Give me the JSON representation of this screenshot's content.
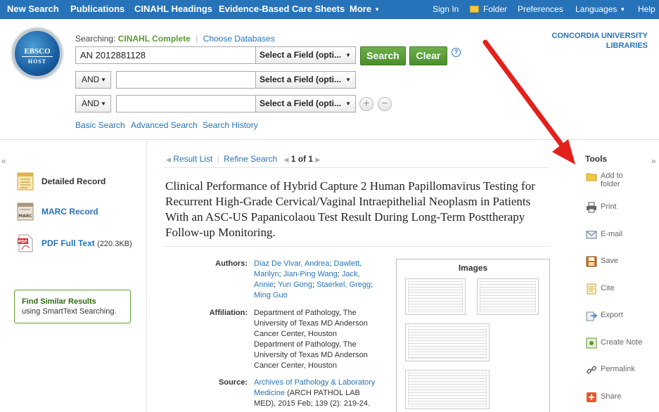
{
  "nav": {
    "items": [
      "New Search",
      "Publications",
      "CINAHL Headings",
      "Evidence-Based Care Sheets",
      "More"
    ],
    "right": [
      "Sign In",
      "Folder",
      "Preferences",
      "Languages",
      "Help"
    ]
  },
  "logo": {
    "line1": "EBSCO",
    "line2": "HOST"
  },
  "search": {
    "searching_label": "Searching:",
    "database": "CINAHL Complete",
    "choose_db": "Choose Databases",
    "row1_value": "AN 2012881128",
    "field_select": "Select a Field (opti...",
    "bool1": "AND",
    "bool2": "AND",
    "search_btn": "Search",
    "clear_btn": "Clear",
    "help": "?",
    "add_row": "+",
    "remove_row": "−",
    "links": [
      "Basic Search",
      "Advanced Search",
      "Search History"
    ]
  },
  "institution": {
    "line1": "CONCORDIA UNIVERSITY",
    "line2": "LIBRARIES"
  },
  "left": {
    "collapse": "«",
    "detailed": "Detailed Record",
    "marc": "MARC Record",
    "marc_icon_text": "MARC",
    "pdf": "PDF Full Text",
    "pdf_icon_text": "PDF",
    "pdf_size": "(220.3KB)",
    "similar_title": "Find Similar Results",
    "similar_sub": "using SmartText Searching."
  },
  "record": {
    "result_list": "Result List",
    "refine": "Refine Search",
    "page": "1 of 1",
    "title": "Clinical Performance of Hybrid Capture 2 Human Papillomavirus Testing for Recurrent High-Grade Cervical/Vaginal Intraepithelial Neoplasm in Patients With an ASC-US Papanicolaou Test Result During Long-Term Posttherapy Follow-up Monitoring.",
    "authors_label": "Authors:",
    "authors": [
      "Diaz De Vivar, Andrea",
      "Dawlett, Marilyn",
      "Jian-Ping Wang",
      "Jack, Annie",
      "Yun Gong",
      "Staerkel, Gregg",
      "Ming Guo"
    ],
    "affiliation_label": "Affiliation:",
    "affiliation": "The University of Texas MD Anderson Cancer Center, Houston",
    "affiliation2": "The University of Texas MD Anderson Cancer Center, Houston",
    "affiliation_dept": "Department of Pathology,",
    "source_label": "Source:",
    "source_journal": "Archives of Pathology & Laboratory Medicine",
    "source_rest": "(ARCH PATHOL LAB MED), 2015 Feb; 139 (2): 219-24.",
    "images_title": "Images"
  },
  "tools": {
    "title": "Tools",
    "expand": "»",
    "items": [
      "Add to folder",
      "Print",
      "E-mail",
      "Save",
      "Cite",
      "Export",
      "Create Note",
      "Permalink",
      "Share"
    ]
  },
  "colors": {
    "nav": "#2773b9",
    "green": "#5d9b2e",
    "link": "#2773b9",
    "arrow": "#e3201b"
  }
}
